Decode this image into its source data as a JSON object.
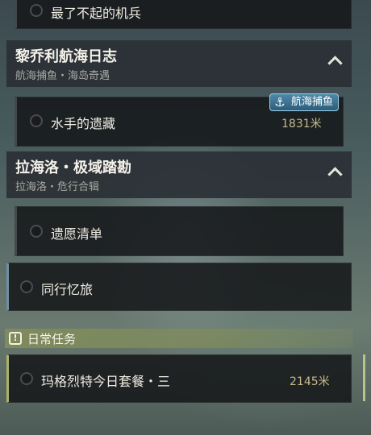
{
  "quests": [
    {
      "title": "最了不起的机兵",
      "distance": ""
    },
    {
      "title": "水手的遗藏",
      "distance": "1831米"
    },
    {
      "title": "遗愿清单",
      "distance": ""
    },
    {
      "title": "同行忆旅",
      "distance": ""
    },
    {
      "title": "玛格烈特今日套餐・三",
      "distance": "2145米"
    }
  ],
  "groups": [
    {
      "title": "黎乔利航海日志",
      "subtitle": "航海捕鱼・海岛奇遇"
    },
    {
      "title": "拉海洛・极域踏勘",
      "subtitle": "拉海洛・危行合辑"
    }
  ],
  "tag": {
    "label": "航海捕鱼",
    "icon": "anchor-icon"
  },
  "daily": {
    "label": "日常任务",
    "icon": "exclamation-icon"
  },
  "colors": {
    "accent_daily": "#8a9460",
    "accent_tag": "#3d7597",
    "distance_text": "#c7b98d"
  }
}
